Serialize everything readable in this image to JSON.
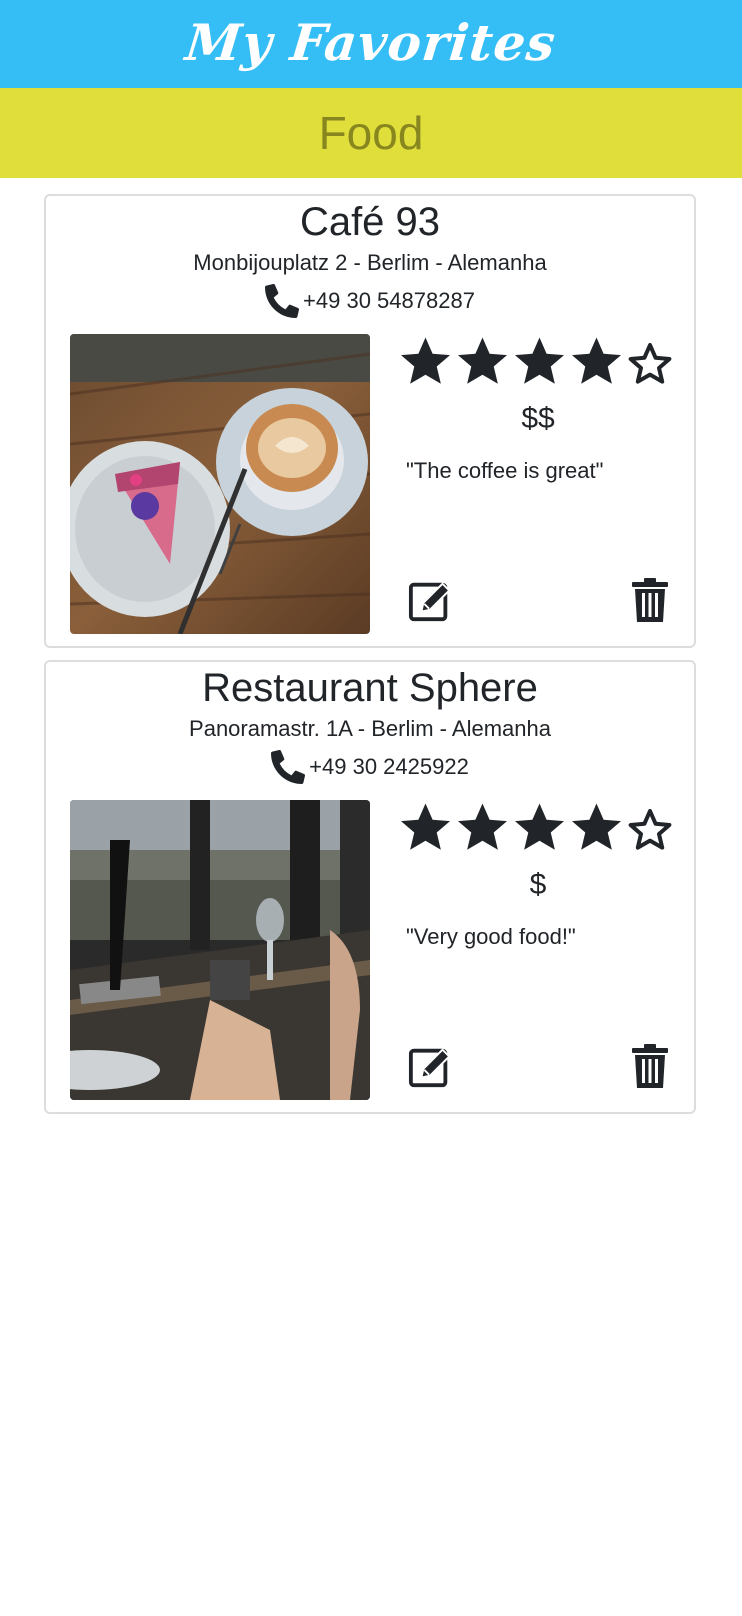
{
  "app": {
    "title": "My Favorites",
    "header_color": "#35bdf5",
    "category_color": "#e0de3a"
  },
  "category": {
    "label": "Food"
  },
  "places": [
    {
      "name": "Café 93",
      "address": "Monbijouplatz 2 - Berlim - Alemanha",
      "phone": "+49 30 54878287",
      "rating": 4,
      "max_rating": 5,
      "price": "$$",
      "review": "\"The coffee is great\"",
      "photo": "coffee-and-cake-photo"
    },
    {
      "name": "Restaurant Sphere",
      "address": "Panoramastr. 1A - Berlim - Alemanha",
      "phone": "+49 30 2425922",
      "rating": 4,
      "max_rating": 5,
      "price": "$",
      "review": "\"Very good food!\"",
      "photo": "restaurant-view-photo"
    }
  ],
  "icons": {
    "phone": "phone-icon",
    "star_filled": "star-filled-icon",
    "star_empty": "star-empty-icon",
    "edit": "edit-icon",
    "delete": "trash-icon"
  }
}
